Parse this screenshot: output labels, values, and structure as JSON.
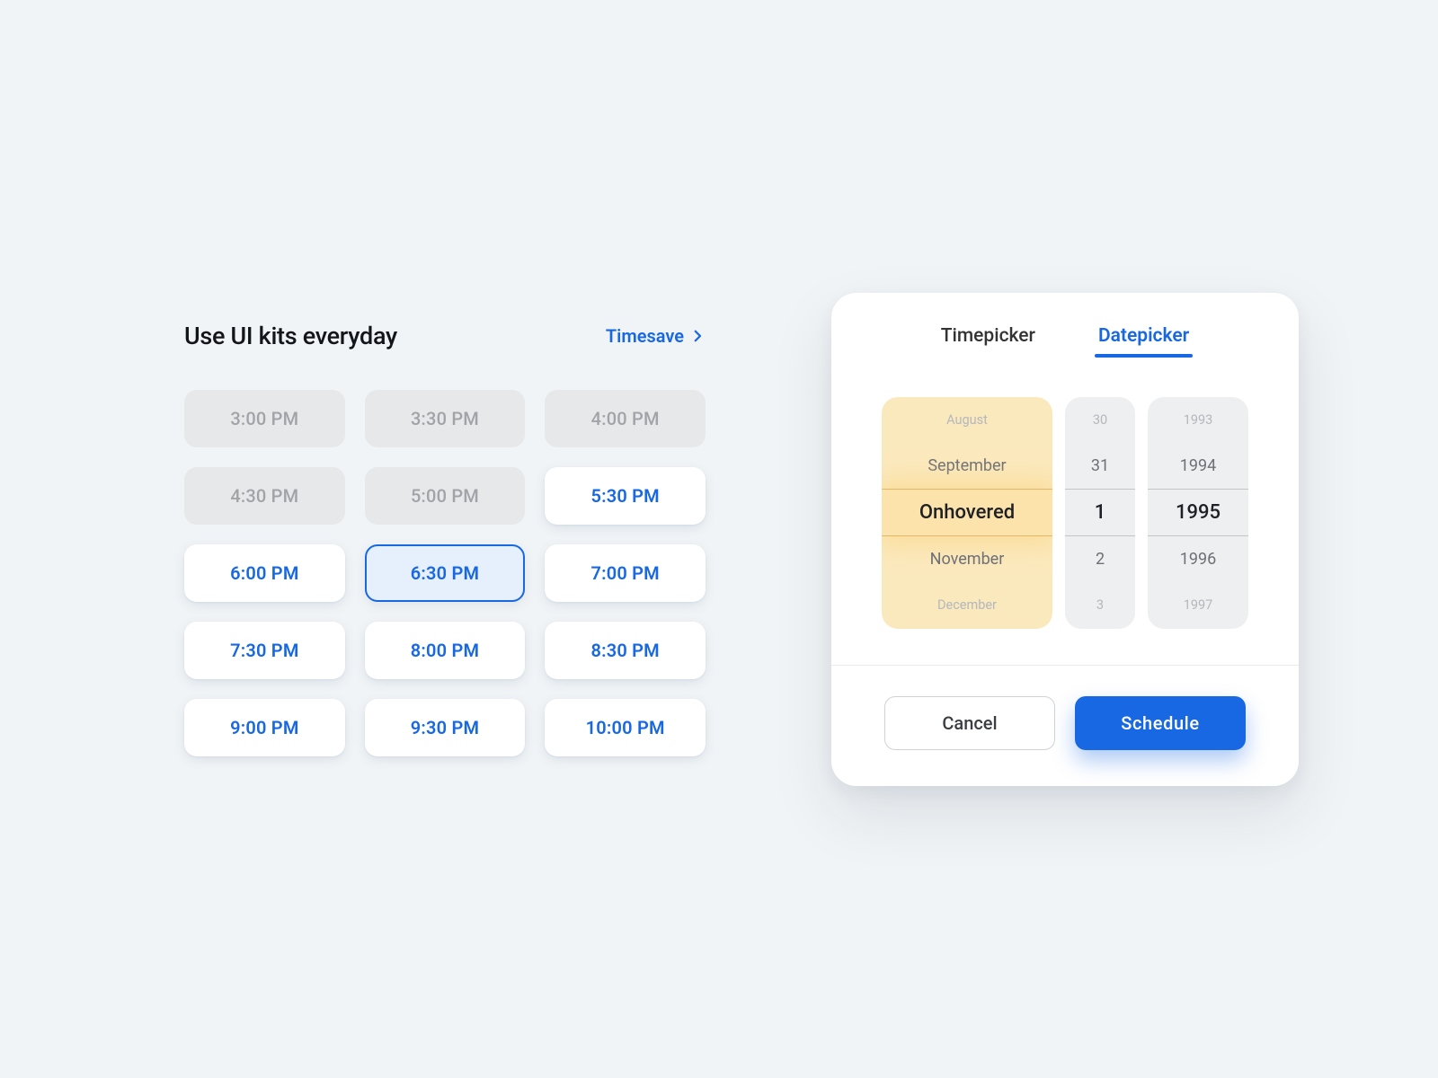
{
  "time_panel": {
    "title": "Use UI kits everyday",
    "link_label": "Timesave",
    "slots": [
      {
        "label": "3:00 PM",
        "state": "disabled"
      },
      {
        "label": "3:30 PM",
        "state": "disabled"
      },
      {
        "label": "4:00 PM",
        "state": "disabled"
      },
      {
        "label": "4:30 PM",
        "state": "disabled"
      },
      {
        "label": "5:00 PM",
        "state": "disabled"
      },
      {
        "label": "5:30 PM",
        "state": "available"
      },
      {
        "label": "6:00 PM",
        "state": "available"
      },
      {
        "label": "6:30 PM",
        "state": "selected"
      },
      {
        "label": "7:00 PM",
        "state": "available"
      },
      {
        "label": "7:30 PM",
        "state": "available"
      },
      {
        "label": "8:00 PM",
        "state": "available"
      },
      {
        "label": "8:30 PM",
        "state": "available"
      },
      {
        "label": "9:00 PM",
        "state": "available"
      },
      {
        "label": "9:30 PM",
        "state": "available"
      },
      {
        "label": "10:00 PM",
        "state": "available"
      }
    ]
  },
  "picker": {
    "tabs": {
      "timepicker": "Timepicker",
      "datepicker": "Datepicker",
      "active": "datepicker"
    },
    "month_wheel": [
      "August",
      "September",
      "Onhovered",
      "November",
      "December"
    ],
    "day_wheel": [
      "30",
      "31",
      "1",
      "2",
      "3"
    ],
    "year_wheel": [
      "1993",
      "1994",
      "1995",
      "1996",
      "1997"
    ],
    "buttons": {
      "cancel": "Cancel",
      "schedule": "Schedule"
    }
  }
}
